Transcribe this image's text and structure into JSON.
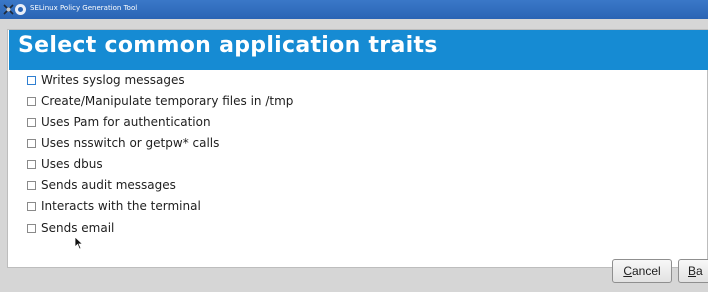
{
  "window": {
    "title": "SELinux Policy Generation Tool"
  },
  "header": {
    "title": "Select common application traits",
    "background": "#168bd3"
  },
  "traits": [
    {
      "label": "Writes syslog messages",
      "checked": false,
      "focused": true
    },
    {
      "label": "Create/Manipulate temporary files in /tmp",
      "checked": false
    },
    {
      "label": "Uses Pam for authentication",
      "checked": false
    },
    {
      "label": "Uses nsswitch or getpw* calls",
      "checked": false
    },
    {
      "label": "Uses dbus",
      "checked": false
    },
    {
      "label": "Sends audit messages",
      "checked": false
    },
    {
      "label": "Interacts with the terminal",
      "checked": false
    },
    {
      "label": "Sends email",
      "checked": false
    }
  ],
  "buttons": {
    "cancel": "Cancel",
    "back": "Ba"
  }
}
